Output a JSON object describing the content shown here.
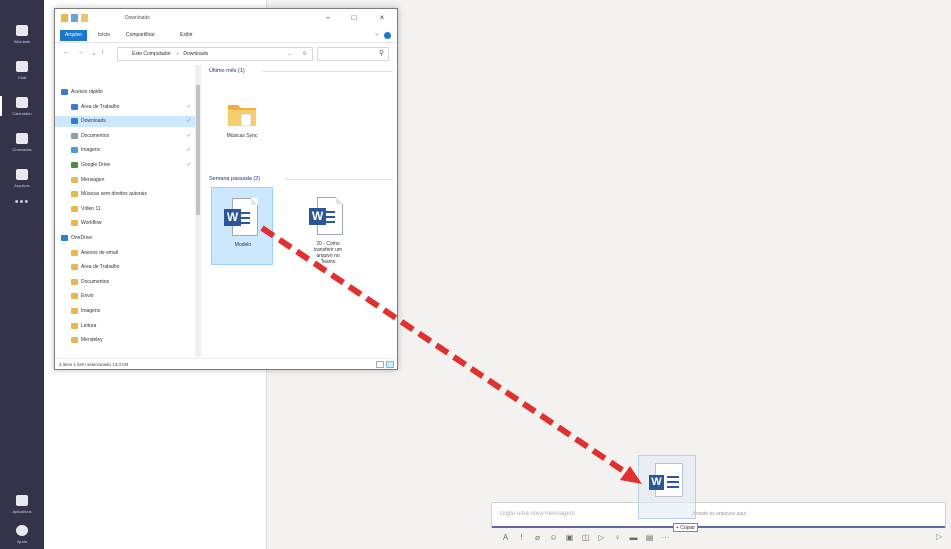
{
  "teams": {
    "rail": [
      {
        "label": "Atividade",
        "icon": "activity-icon"
      },
      {
        "label": "Chat",
        "icon": "chat-icon"
      },
      {
        "label": "Calendário",
        "icon": "calendar-icon"
      },
      {
        "label": "Chamadas",
        "icon": "calls-icon"
      },
      {
        "label": "Arquivos",
        "icon": "files-icon"
      }
    ],
    "more": "•••",
    "bottom_rail": [
      {
        "label": "Aplicativos",
        "icon": "apps-icon"
      },
      {
        "label": "Ajuda",
        "icon": "help-icon"
      }
    ],
    "compose": {
      "placeholder": "Digite uma nova mensagem",
      "drop_hint": "Arraste os arquivos aqui"
    },
    "colors": {
      "rail": "#33344a",
      "accent": "#6264a7"
    }
  },
  "explorer": {
    "title": "Downloads",
    "ribbon_tabs": [
      "Arquivo",
      "Início",
      "Compartilhar",
      "Exibir"
    ],
    "address": [
      "Este Computador",
      "Downloads"
    ],
    "nav_tree": [
      {
        "label": "Acesso rápido",
        "type": "star",
        "indent": 0
      },
      {
        "label": "Área de Trabalho",
        "type": "desk",
        "indent": 1,
        "pinned": true
      },
      {
        "label": "Downloads",
        "type": "down",
        "indent": 1,
        "pinned": true,
        "selected": true
      },
      {
        "label": "Documentos",
        "type": "doc",
        "indent": 1,
        "pinned": true
      },
      {
        "label": "Imagens",
        "type": "img",
        "indent": 1,
        "pinned": true
      },
      {
        "label": "Google Drive",
        "type": "gdrive",
        "indent": 1,
        "pinned": true
      },
      {
        "label": "Mensagen",
        "type": "folder",
        "indent": 1
      },
      {
        "label": "Músicas sem direitos autorais",
        "type": "folder",
        "indent": 1
      },
      {
        "label": "Vídeo 11",
        "type": "folder",
        "indent": 1
      },
      {
        "label": "Workflow",
        "type": "folder",
        "indent": 1
      },
      {
        "label": "OneDrive",
        "type": "cloud",
        "indent": 0
      },
      {
        "label": "Anexos de email",
        "type": "folder",
        "indent": 1
      },
      {
        "label": "Área de Trabalho",
        "type": "folder",
        "indent": 1
      },
      {
        "label": "Documentos",
        "type": "folder",
        "indent": 1
      },
      {
        "label": "Envio",
        "type": "folder",
        "indent": 1
      },
      {
        "label": "Imagens",
        "type": "folder",
        "indent": 1
      },
      {
        "label": "Leitura",
        "type": "folder",
        "indent": 1
      },
      {
        "label": "Mendeley",
        "type": "folder",
        "indent": 1
      }
    ],
    "groups": [
      {
        "header": "Último mês (1)",
        "files": [
          {
            "name": "Músicas Sync",
            "kind": "folder"
          }
        ]
      },
      {
        "header": "Semana passada (2)",
        "files": [
          {
            "name": "Modelo",
            "kind": "word",
            "selected": true
          },
          {
            "name": "20 - Como transferir um arquivo no Teams",
            "kind": "word"
          }
        ]
      }
    ],
    "status": "3 itens    1 item selecionado 13,3 KB"
  },
  "drag": {
    "tooltip": "+ Copiar"
  }
}
